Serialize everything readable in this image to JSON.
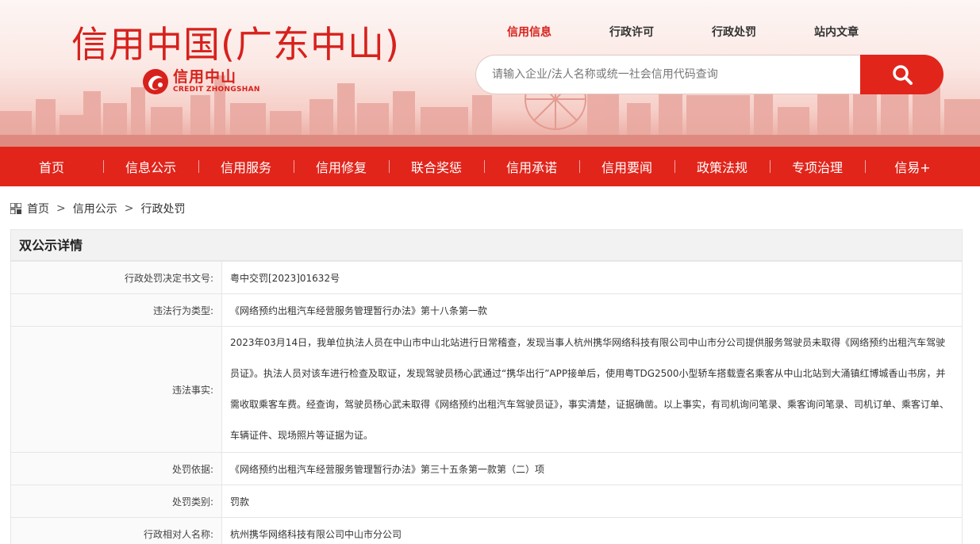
{
  "header": {
    "site_title": "信用中国(广东中山)",
    "logo_cn": "信用中山",
    "logo_en": "CREDIT ZHONGSHAN",
    "brand_color": "#e1251b"
  },
  "top_links": [
    "信用信息",
    "行政许可",
    "行政处罚",
    "站内文章"
  ],
  "search": {
    "placeholder": "请输入企业/法人名称或统一社会信用代码查询",
    "button_icon": "search-icon"
  },
  "nav": [
    "首页",
    "信息公示",
    "信用服务",
    "信用修复",
    "联合奖惩",
    "信用承诺",
    "信用要闻",
    "政策法规",
    "专项治理",
    "信易+"
  ],
  "breadcrumb": [
    "首页",
    "信用公示",
    "行政处罚"
  ],
  "detail": {
    "title": "双公示详情",
    "rows": [
      {
        "label": "行政处罚决定书文号:",
        "value": "粤中交罚[2023]01632号"
      },
      {
        "label": "违法行为类型:",
        "value": "《网络预约出租汽车经营服务管理暂行办法》第十八条第一款"
      },
      {
        "label": "违法事实:",
        "value": "2023年03月14日，我单位执法人员在中山市中山北站进行日常稽查，发现当事人杭州携华网络科技有限公司中山市分公司提供服务驾驶员未取得《网络预约出租汽车驾驶员证》。执法人员对该车进行检查及取证，发现驾驶员杨心武通过“携华出行”APP接单后，使用粤TDG2500小型轿车搭载壹名乘客从中山北站到大涌镇红博城香山书房，并需收取乘客车费。经查询，驾驶员杨心武未取得《网络预约出租汽车驾驶员证》，事实清楚，证据确凿。以上事实，有司机询问笔录、乘客询问笔录、司机订单、乘客订单、车辆证件、现场照片等证据为证。"
      },
      {
        "label": "处罚依据:",
        "value": "《网络预约出租汽车经营服务管理暂行办法》第三十五条第一款第（二）项"
      },
      {
        "label": "处罚类别:",
        "value": "罚款"
      },
      {
        "label": "行政相对人名称:",
        "value": "杭州携华网络科技有限公司中山市分公司"
      }
    ]
  }
}
